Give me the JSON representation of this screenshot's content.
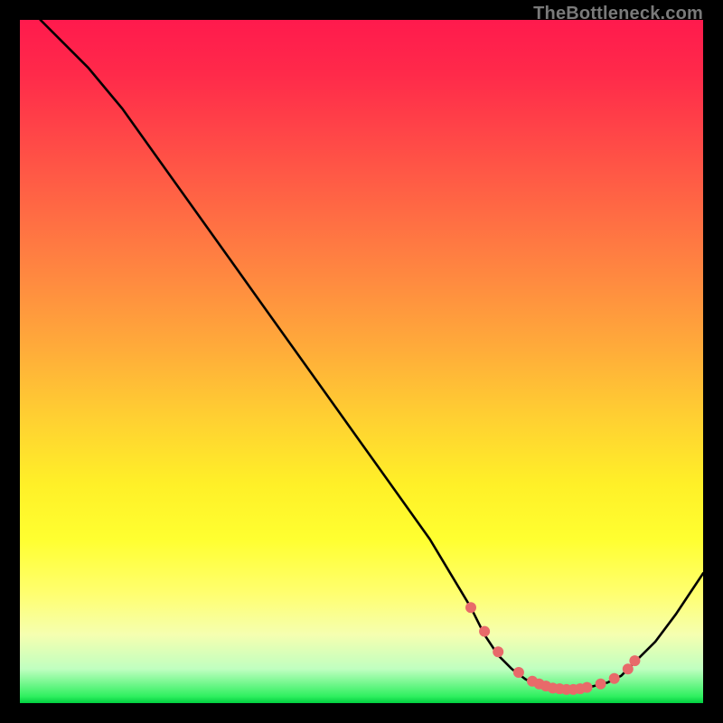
{
  "watermark": "TheBottleneck.com",
  "chart_data": {
    "type": "line",
    "title": "",
    "xlabel": "",
    "ylabel": "",
    "xlim": [
      0,
      100
    ],
    "ylim": [
      0,
      100
    ],
    "grid": false,
    "legend": false,
    "series": [
      {
        "name": "bottleneck-curve",
        "x": [
          3,
          6,
          10,
          15,
          20,
          25,
          30,
          35,
          40,
          45,
          50,
          55,
          60,
          63,
          66,
          68,
          70,
          72,
          74,
          76,
          78,
          80,
          82,
          84,
          86,
          88,
          90,
          93,
          96,
          100
        ],
        "y": [
          100,
          97,
          93,
          87,
          80,
          73,
          66,
          59,
          52,
          45,
          38,
          31,
          24,
          19,
          14,
          10,
          7,
          5,
          3.5,
          2.5,
          2,
          2,
          2,
          2.5,
          3,
          4,
          6,
          9,
          13,
          19
        ]
      }
    ],
    "markers": {
      "name": "highlight-dots",
      "x": [
        66,
        68,
        70,
        73,
        75,
        76,
        77,
        78,
        79,
        80,
        81,
        82,
        83,
        85,
        87,
        89,
        90
      ],
      "y": [
        14,
        10.5,
        7.5,
        4.5,
        3.2,
        2.8,
        2.5,
        2.2,
        2.1,
        2.0,
        2.0,
        2.1,
        2.3,
        2.8,
        3.6,
        5.0,
        6.2
      ]
    }
  }
}
